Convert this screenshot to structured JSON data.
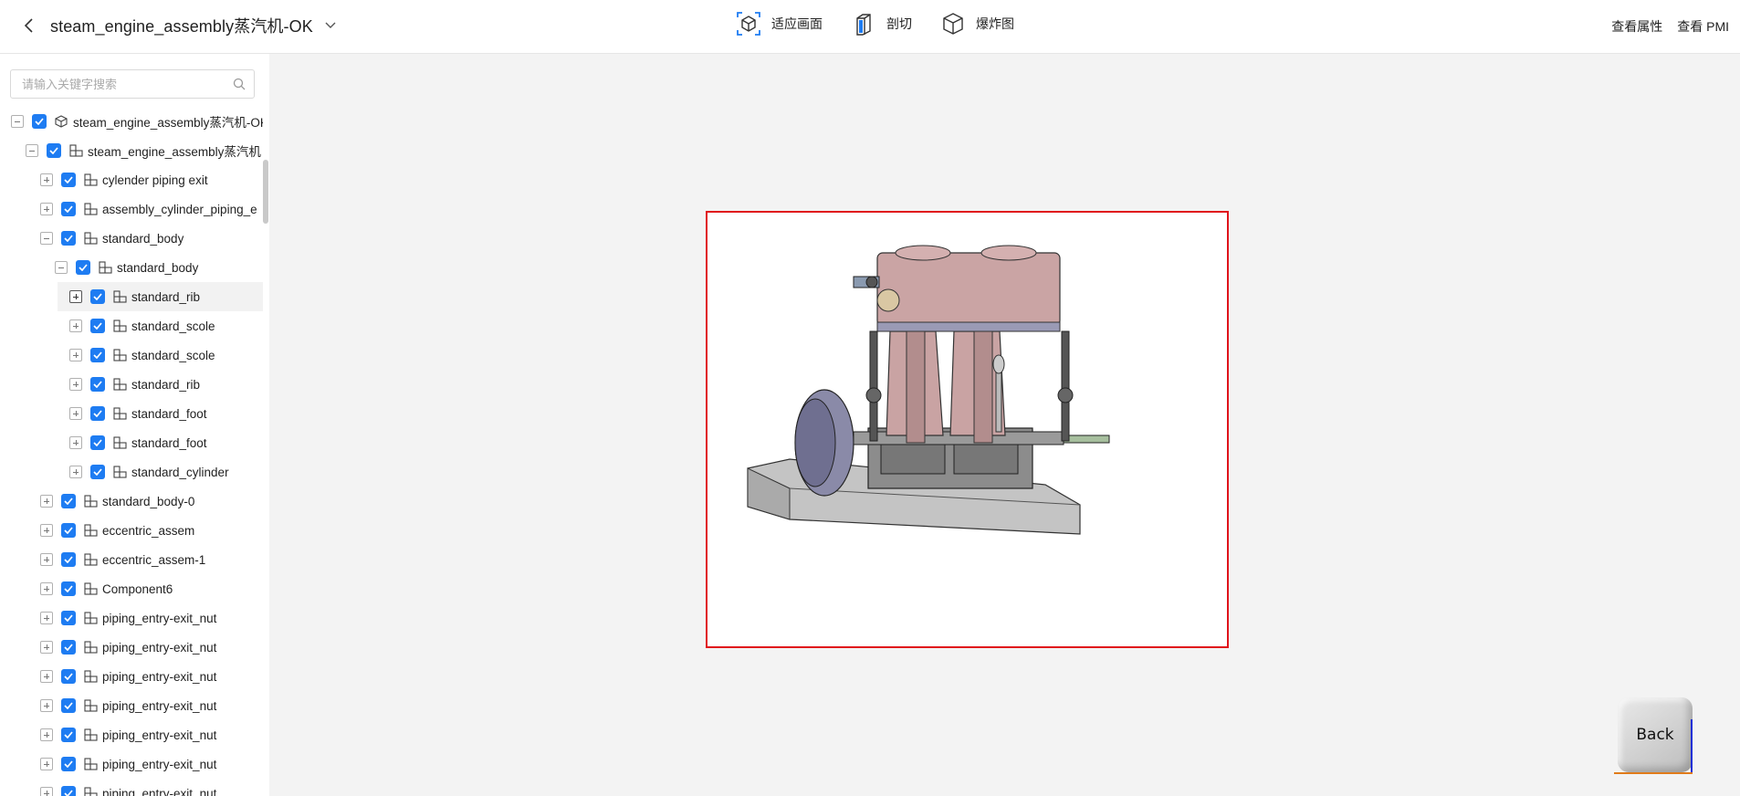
{
  "header": {
    "title": "steam_engine_assembly蒸汽机-OK",
    "toolbar": [
      {
        "label": "适应画面",
        "icon": "fit-view-icon"
      },
      {
        "label": "剖切",
        "icon": "section-cut-icon"
      },
      {
        "label": "爆炸图",
        "icon": "explode-view-icon"
      }
    ],
    "links": {
      "properties": "查看属性",
      "pmi": "查看 PMI"
    }
  },
  "search": {
    "placeholder": "请输入关键字搜索"
  },
  "tree": [
    {
      "label": "steam_engine_assembly蒸汽机-OK",
      "level": 0,
      "toggle": "minus",
      "icon": "part-cube-icon",
      "checked": true
    },
    {
      "label": "steam_engine_assembly蒸汽机",
      "level": 1,
      "toggle": "minus",
      "icon": "assembly-icon",
      "checked": true
    },
    {
      "label": "cylender piping exit",
      "level": 2,
      "toggle": "plus",
      "icon": "assembly-icon",
      "checked": true
    },
    {
      "label": "assembly_cylinder_piping_e",
      "level": 2,
      "toggle": "plus",
      "icon": "assembly-icon",
      "checked": true
    },
    {
      "label": "standard_body",
      "level": 2,
      "toggle": "minus",
      "icon": "assembly-icon",
      "checked": true
    },
    {
      "label": "standard_body",
      "level": 3,
      "toggle": "minus",
      "icon": "assembly-icon",
      "checked": true
    },
    {
      "label": "standard_rib",
      "level": 4,
      "toggle": "plus",
      "icon": "assembly-icon",
      "checked": true,
      "highlight": true
    },
    {
      "label": "standard_scole",
      "level": 4,
      "toggle": "plus",
      "icon": "assembly-icon",
      "checked": true
    },
    {
      "label": "standard_scole",
      "level": 4,
      "toggle": "plus",
      "icon": "assembly-icon",
      "checked": true
    },
    {
      "label": "standard_rib",
      "level": 4,
      "toggle": "plus",
      "icon": "assembly-icon",
      "checked": true
    },
    {
      "label": "standard_foot",
      "level": 4,
      "toggle": "plus",
      "icon": "assembly-icon",
      "checked": true
    },
    {
      "label": "standard_foot",
      "level": 4,
      "toggle": "plus",
      "icon": "assembly-icon",
      "checked": true
    },
    {
      "label": "standard_cylinder",
      "level": 4,
      "toggle": "plus",
      "icon": "assembly-icon",
      "checked": true
    },
    {
      "label": "standard_body-0",
      "level": 2,
      "toggle": "plus",
      "icon": "assembly-icon",
      "checked": true
    },
    {
      "label": "eccentric_assem",
      "level": 2,
      "toggle": "plus",
      "icon": "assembly-icon",
      "checked": true
    },
    {
      "label": "eccentric_assem-1",
      "level": 2,
      "toggle": "plus",
      "icon": "assembly-icon",
      "checked": true
    },
    {
      "label": "Component6",
      "level": 2,
      "toggle": "plus",
      "icon": "assembly-icon",
      "checked": true
    },
    {
      "label": "piping_entry-exit_nut",
      "level": 2,
      "toggle": "plus",
      "icon": "assembly-icon",
      "checked": true
    },
    {
      "label": "piping_entry-exit_nut",
      "level": 2,
      "toggle": "plus",
      "icon": "assembly-icon",
      "checked": true
    },
    {
      "label": "piping_entry-exit_nut",
      "level": 2,
      "toggle": "plus",
      "icon": "assembly-icon",
      "checked": true
    },
    {
      "label": "piping_entry-exit_nut",
      "level": 2,
      "toggle": "plus",
      "icon": "assembly-icon",
      "checked": true
    },
    {
      "label": "piping_entry-exit_nut",
      "level": 2,
      "toggle": "plus",
      "icon": "assembly-icon",
      "checked": true
    },
    {
      "label": "piping_entry-exit_nut",
      "level": 2,
      "toggle": "plus",
      "icon": "assembly-icon",
      "checked": true
    },
    {
      "label": "piping_entry-exit_nut",
      "level": 2,
      "toggle": "plus",
      "icon": "assembly-icon",
      "checked": true
    }
  ],
  "viewcube": {
    "face_label": "Back"
  },
  "colors": {
    "accent": "#1e7cf2",
    "selection_frame": "#e0141c",
    "engine_body": "#c9a3a3",
    "flywheel": "#8a8aa8",
    "base": "#c4c4c4"
  }
}
